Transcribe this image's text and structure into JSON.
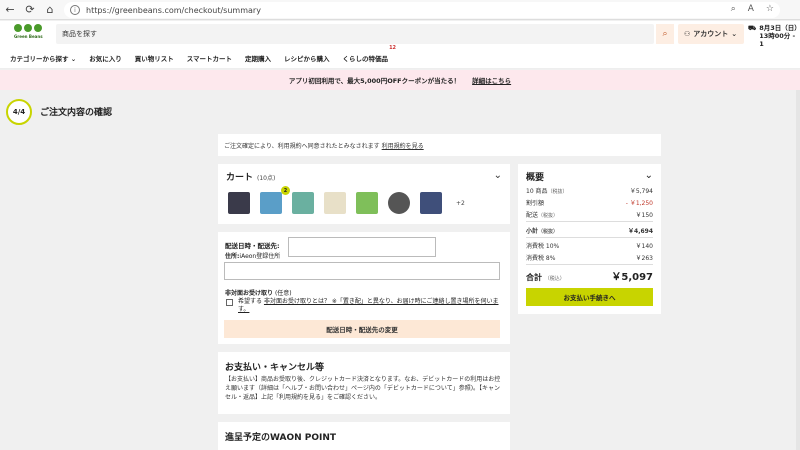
{
  "browser": {
    "url": "https://greenbeans.com/checkout/summary",
    "back": "←",
    "reload": "⟳",
    "home": "⌂"
  },
  "header": {
    "logo_text": "Green Beans",
    "search_placeholder": "商品を探す",
    "account_label": "アカウント",
    "delivery_line1": "8月3日（日）",
    "delivery_line2": "13時00分 - 1"
  },
  "catnav": {
    "items": [
      "カテゴリーから探す",
      "お気に入り",
      "買い物リスト",
      "スマートカート",
      "定期購入",
      "レシピから購入",
      "くらしの特価品"
    ],
    "badge": "12"
  },
  "promo": {
    "text": "アプリ初回利用で、最大5,000円OFFクーポンが当たる！",
    "link": "詳細はこちら"
  },
  "step": {
    "badge": "4/4",
    "title": "ご注文内容の確認"
  },
  "terms": {
    "text": "ご注文確定により、利用規約へ同意されたとみなされます",
    "link": "利用規約を見る"
  },
  "cart": {
    "title": "カート",
    "count": "(10点)",
    "qty_badge": "2",
    "more": "+2",
    "product_colors": [
      "#3a3a4a",
      "#5a9ec8",
      "#6ab0a0",
      "#e8e0c8",
      "#7fbf5a",
      "#555555",
      "#3f4f7a"
    ]
  },
  "shipping": {
    "label_datetime": "配送日時・配送先:",
    "label_address_bold": "住所:",
    "label_address": "iAeon登録住所",
    "label_unattended_bold": "非対面お受け取り",
    "label_unattended": "(任意)",
    "option_text": "希望する",
    "option_link": "非対面お受け取りとは？ ※「置き配」と異なり、お届け時にご連絡し置き場所を伺います。",
    "change_button": "配送日時・配送先の変更"
  },
  "payment": {
    "title": "お支払い・キャンセル等",
    "body": "【お支払い】商品お受取り後、クレジットカード決済となります。なお、デビットカードの利用はお控え願います（詳細は「ヘルプ・お問い合わせ」ページ内の「デビットカードについて」参照)。【キャンセル・返品】上記「利用規約を見る」をご確認ください。"
  },
  "waon": {
    "title": "進呈予定のWAON POINT"
  },
  "summary": {
    "title": "概要",
    "rows": [
      {
        "label": "10 商品",
        "note": "（税抜）",
        "value": "￥5,794"
      },
      {
        "label": "割引額",
        "note": "",
        "value": "- ￥1,250"
      },
      {
        "label": "配送",
        "note": "（税抜）",
        "value": "￥150"
      },
      {
        "label": "小計",
        "note": "（税抜）",
        "value": "￥4,694"
      },
      {
        "label": "消費税 10%",
        "note": "",
        "value": "￥140"
      },
      {
        "label": "消費税 8%",
        "note": "",
        "value": "￥263"
      }
    ],
    "total_label": "合計",
    "total_note": "（税込）",
    "total_value": "￥5,097",
    "pay_button": "お支払い手続きへ"
  }
}
